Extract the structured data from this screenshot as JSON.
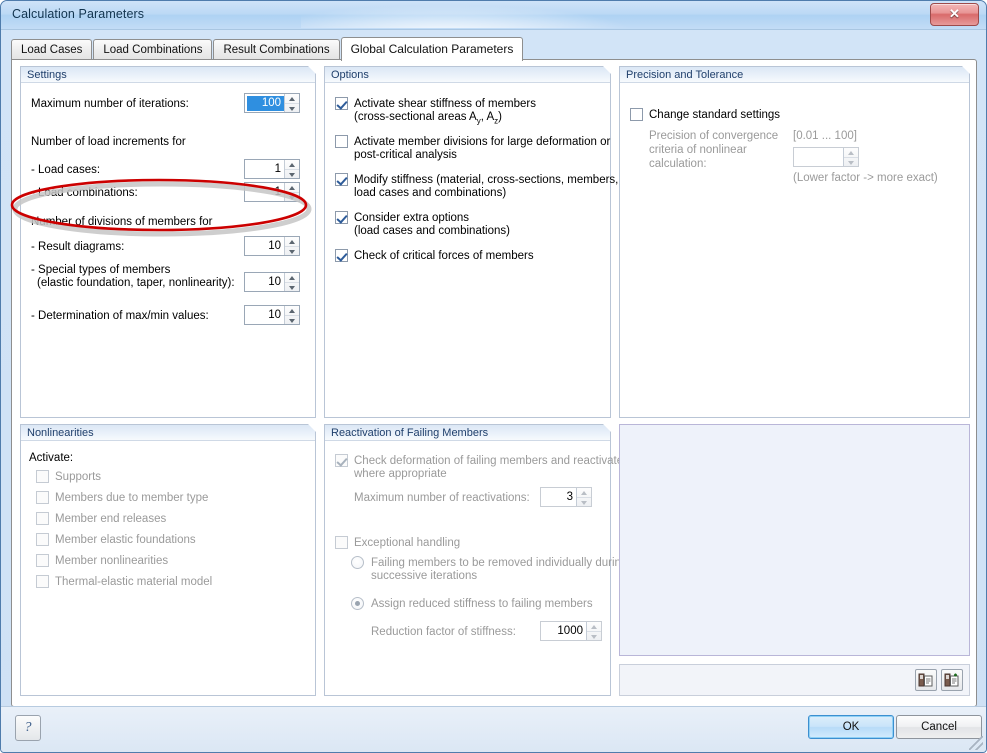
{
  "window": {
    "title": "Calculation Parameters",
    "close_label": "✕"
  },
  "tabs": [
    {
      "label": "Load Cases",
      "active": false
    },
    {
      "label": "Load Combinations",
      "active": false
    },
    {
      "label": "Result Combinations",
      "active": false
    },
    {
      "label": "Global Calculation Parameters",
      "active": true
    }
  ],
  "settings": {
    "header": "Settings",
    "max_iterations_label": "Maximum number of iterations:",
    "max_iterations_value": "100",
    "load_increments_label": "Number of load increments for",
    "load_cases_label": "- Load cases:",
    "load_cases_value": "1",
    "load_combinations_label": "- Load combinations:",
    "load_combinations_value": "1",
    "divisions_label": "Number of divisions of members for",
    "result_diagrams_label": "- Result diagrams:",
    "result_diagrams_value": "10",
    "special_types_label_1": "- Special types of members",
    "special_types_label_2": "(elastic foundation, taper, nonlinearity):",
    "special_types_value": "10",
    "maxmin_label": "- Determination of max/min values:",
    "maxmin_value": "10"
  },
  "options": {
    "header": "Options",
    "items": [
      {
        "line1": "Activate shear stiffness of members",
        "line2": "(cross-sectional areas A",
        "sub1": "y",
        "mid": ", A",
        "sub2": "z",
        "tail": ")",
        "checked": true,
        "two_line": true
      },
      {
        "line1": "Activate member divisions for large deformation or",
        "line2": "post-critical analysis",
        "checked": false,
        "two_line": true
      },
      {
        "line1": "Modify stiffness (material, cross-sections, members,",
        "line2": "load cases and combinations)",
        "checked": true,
        "two_line": true
      },
      {
        "line1": "Consider extra options",
        "line2": "(load cases and combinations)",
        "checked": true,
        "two_line": true
      },
      {
        "line1": "Check of critical forces of members",
        "line2": "",
        "checked": true,
        "two_line": false
      }
    ]
  },
  "precision": {
    "header": "Precision and Tolerance",
    "change_standard_label": "Change standard settings",
    "change_standard_checked": false,
    "precision_label_l1": "Precision of convergence",
    "precision_label_l2": "criteria of nonlinear",
    "precision_label_l3": "calculation:",
    "range_label": "[0.01 ... 100]",
    "precision_value": "",
    "hint_label": "(Lower factor -> more exact)"
  },
  "nonlinearities": {
    "header": "Nonlinearities",
    "activate_label": "Activate:",
    "items": [
      {
        "label": "Supports",
        "checked": false
      },
      {
        "label": "Members due to member type",
        "checked": false
      },
      {
        "label": "Member end releases",
        "checked": false
      },
      {
        "label": "Member elastic foundations",
        "checked": false
      },
      {
        "label": "Member nonlinearities",
        "checked": false
      },
      {
        "label": "Thermal-elastic material model",
        "checked": false
      }
    ]
  },
  "reactivation": {
    "header": "Reactivation of Failing Members",
    "check_deformation_l1": "Check deformation of failing members and reactivate",
    "check_deformation_l2": "where appropriate",
    "check_deformation_checked": true,
    "max_reactivations_label": "Maximum number of reactivations:",
    "max_reactivations_value": "3",
    "exceptional_label": "Exceptional handling",
    "exceptional_checked": false,
    "radio_remove_l1": "Failing members to be removed individually during",
    "radio_remove_l2": "successive iterations",
    "radio_remove_selected": false,
    "radio_reduced_label": "Assign reduced stiffness to failing members",
    "radio_reduced_selected": true,
    "reduction_factor_label": "Reduction factor of stiffness:",
    "reduction_factor_value": "1000"
  },
  "toolstrip": {
    "button1_name": "copy-settings-icon",
    "button2_name": "paste-settings-icon"
  },
  "footer": {
    "help_label": "?",
    "ok_label": "OK",
    "cancel_label": "Cancel"
  },
  "annotation": {
    "type": "ellipse",
    "color": "#cc0000",
    "shadow": "#c6c6c6",
    "target": "Number of divisions of members for / - Result diagrams"
  }
}
